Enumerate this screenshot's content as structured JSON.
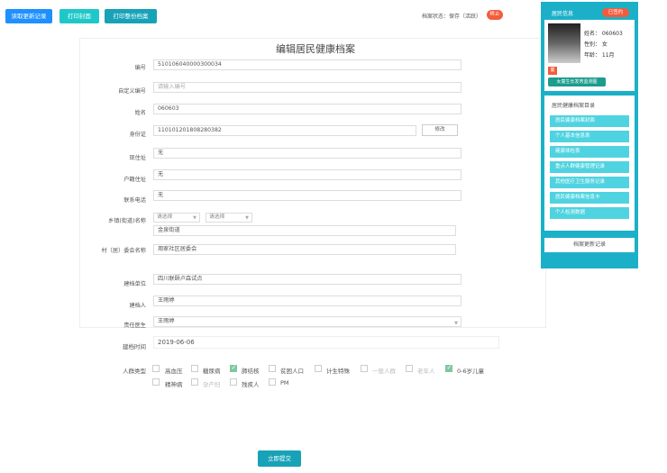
{
  "toolbar": {
    "btn_reading": "读取更新记录",
    "btn_print_cover": "打印封面",
    "btn_print_archive": "打印整份档案",
    "status_label": "档案状态：保存（活跃）",
    "status_badge": "终止"
  },
  "form": {
    "title": "编辑居民健康档案",
    "fields": {
      "number_label": "编号",
      "number_value": "510106040000300034",
      "custom_number_label": "自定义编号",
      "custom_number_placeholder": "请输入编号",
      "name_label": "姓名",
      "name_value": "060603",
      "id_label": "身份证",
      "id_value": "110101201808280382",
      "modify_btn": "修改",
      "residence_label": "现住址",
      "residence_value": "无",
      "household_label": "户籍住址",
      "household_value": "无",
      "phone_label": "联系电话",
      "phone_value": "无",
      "town_label": "乡镇(街道)名称",
      "select1": "请选择",
      "select2": "请选择",
      "town_value": "金泉街道",
      "village_label": "村（居）委会名称",
      "village_value": "周家社区居委会",
      "org_label": "建档单位",
      "org_value": "四川联颐卢森试点",
      "creator_label": "建档人",
      "creator_value": "王雨婷",
      "doctor_label": "责任医生",
      "doctor_value": "王雨婷",
      "date_label": "建档时间",
      "date_value": "2019-06-06",
      "group_label": "人群类型"
    },
    "groups": [
      {
        "label": "高血压",
        "checked": false,
        "muted": false
      },
      {
        "label": "糖尿病",
        "checked": false,
        "muted": false
      },
      {
        "label": "肺结核",
        "checked": true,
        "muted": false
      },
      {
        "label": "贫困人口",
        "checked": false,
        "muted": false
      },
      {
        "label": "计生特殊",
        "checked": false,
        "muted": false
      },
      {
        "label": "一般人群",
        "checked": false,
        "muted": true
      },
      {
        "label": "老年人",
        "checked": false,
        "muted": true
      },
      {
        "label": "0-6岁儿童",
        "checked": true,
        "muted": false
      },
      {
        "label": "精神病",
        "checked": false,
        "muted": false
      },
      {
        "label": "孕产妇",
        "checked": false,
        "muted": true
      },
      {
        "label": "残疾人",
        "checked": false,
        "muted": false
      },
      {
        "label": "PM",
        "checked": false,
        "muted": false
      }
    ],
    "submit": "立即提交"
  },
  "panel": {
    "info_title": "居民信息",
    "info_badge": "已签约",
    "name_line": "姓名：  060603",
    "sex_line": "性别：  女",
    "age_line": "年龄：  11月",
    "tag1": "童",
    "tag2": "女童生长发育监测图",
    "dir_title": "居民健康档案目录",
    "dir_items": [
      "居民健康档案封面",
      "个人基本信息表",
      "健康体检表",
      "重点人群健康管理记录",
      "其他医疗卫生服务记录",
      "居民健康档案信息卡",
      "个人检测数据"
    ],
    "update_records": "档案更新记录"
  }
}
